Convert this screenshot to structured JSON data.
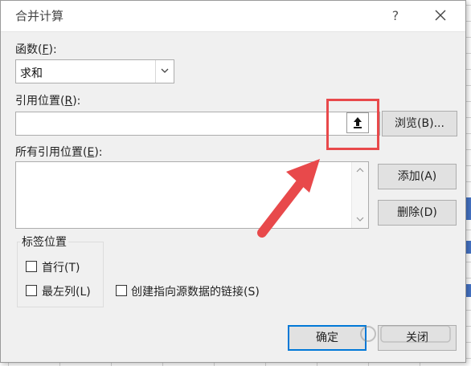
{
  "dialog": {
    "title": "合并计算",
    "help_label": "?",
    "close_icon": "close-icon"
  },
  "function": {
    "label_prefix": "函数(",
    "label_key": "F",
    "label_suffix": "):",
    "selected_value": "求和"
  },
  "reference": {
    "label_prefix": "引用位置(",
    "label_key": "R",
    "label_suffix": "):",
    "value": "",
    "collapse_icon": "collapse-dialog-icon"
  },
  "browse_button": {
    "label": "浏览(B)..."
  },
  "all_references": {
    "label_prefix": "所有引用位置(",
    "label_key": "E",
    "label_suffix": "):",
    "items": []
  },
  "add_button": {
    "label": "添加(A)"
  },
  "delete_button": {
    "label": "删除(D)"
  },
  "label_position": {
    "group_label": "标签位置",
    "first_row": {
      "label": "首行(T)",
      "checked": false
    },
    "left_column": {
      "label": "最左列(L)",
      "checked": false
    }
  },
  "create_links": {
    "label": "创建指向源数据的链接(S)",
    "checked": false
  },
  "ok_button": {
    "label": "确定"
  },
  "close_button": {
    "label": "关闭"
  },
  "colors": {
    "dialog_bg": "#f0f0f0",
    "highlight_red": "#e8494b",
    "primary_border": "#0078d7",
    "sheet_accent": "#4472c4"
  }
}
